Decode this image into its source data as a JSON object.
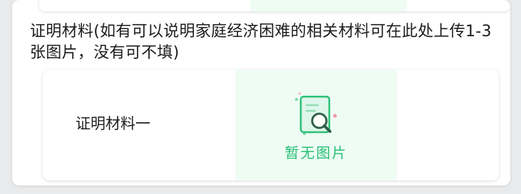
{
  "section": {
    "title": "证明材料(如有可以说明家庭经济困难的相关材料可在此处上传1-3张图片，没有可不填)"
  },
  "upload_item": {
    "label": "证明材料一",
    "placeholder_text": "暂无图片",
    "placeholder_icon": "document-search-icon"
  },
  "colors": {
    "accent_green": "#29bf75",
    "tile_background": "#eefcf4"
  }
}
